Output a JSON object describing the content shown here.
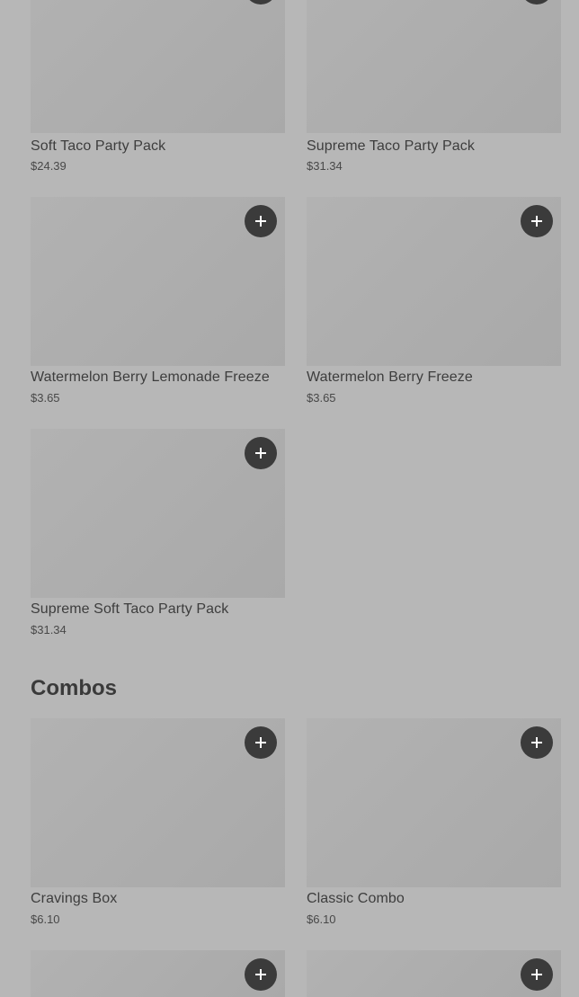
{
  "add_button_label": "+",
  "party_packs": [
    {
      "name": "Soft Taco Party Pack",
      "price": "$24.39"
    },
    {
      "name": "Supreme Taco Party Pack",
      "price": "$31.34"
    },
    {
      "name": "Watermelon Berry Lemonade Freeze",
      "price": "$3.65"
    },
    {
      "name": "Watermelon Berry Freeze",
      "price": "$3.65"
    },
    {
      "name": "Supreme Soft Taco Party Pack",
      "price": "$31.34"
    }
  ],
  "combos_section": {
    "title": "Combos",
    "items": [
      {
        "name": "Cravings Box",
        "price": "$6.10"
      },
      {
        "name": "Classic Combo",
        "price": "$6.10"
      }
    ]
  },
  "icons": {
    "add": "plus-icon"
  },
  "colors": {
    "background": "#b7b7b7",
    "image_placeholder": "#adadad",
    "add_button": "#3b3b3b",
    "add_button_icon": "#ffffff"
  }
}
